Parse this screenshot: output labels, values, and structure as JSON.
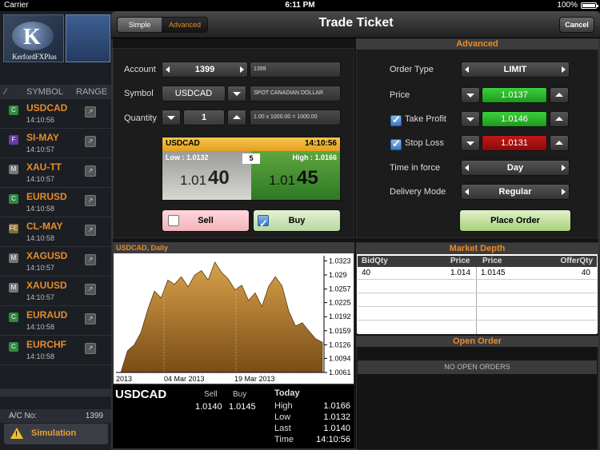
{
  "status_bar": {
    "carrier": "Carrier",
    "time": "6:11 PM",
    "battery": "100%"
  },
  "background_app": {
    "logo_text": "KerfordFXPlus",
    "columns": {
      "symbol": "SYMBOL",
      "range": "RANGE"
    },
    "watchlist": [
      {
        "badge": "C",
        "badge_color": "#2e8b3e",
        "symbol": "USDCAD",
        "time": "14:10:56"
      },
      {
        "badge": "F",
        "badge_color": "#6a3aa8",
        "symbol": "SI-MAY",
        "time": "14:10:57"
      },
      {
        "badge": "M",
        "badge_color": "#777777",
        "symbol": "XAU-TT",
        "time": "14:10:57"
      },
      {
        "badge": "C",
        "badge_color": "#2e8b3e",
        "symbol": "EURUSD",
        "time": "14:10:58"
      },
      {
        "badge": "FE",
        "badge_color": "#8a6a3a",
        "symbol": "CL-MAY",
        "time": "14:10:58"
      },
      {
        "badge": "M",
        "badge_color": "#777777",
        "symbol": "XAGUSD",
        "time": "14:10:57"
      },
      {
        "badge": "M",
        "badge_color": "#777777",
        "symbol": "XAUUSD",
        "time": "14:10:57"
      },
      {
        "badge": "C",
        "badge_color": "#2e8b3e",
        "symbol": "EURAUD",
        "time": "14:10:58"
      },
      {
        "badge": "C",
        "badge_color": "#2e8b3e",
        "symbol": "EURCHF",
        "time": "14:10:58"
      }
    ],
    "account_label": "A/C No:",
    "account_no": "1399",
    "mode": "Simulation"
  },
  "ticket": {
    "tabs": {
      "simple": "Simple",
      "advanced": "Advanced"
    },
    "title": "Trade Ticket",
    "cancel_label": "Cancel",
    "account": {
      "label": "Account",
      "value": "1399",
      "desc": "1399"
    },
    "symbol": {
      "label": "Symbol",
      "value": "USDCAD",
      "desc": "SPOT CANADIAN DOLLAR"
    },
    "quantity": {
      "label": "Quantity",
      "value": "1",
      "desc": "1.00 x 1000.00 = 1000.00"
    },
    "quote": {
      "symbol": "USDCAD",
      "time": "14:10:56",
      "low_label": "Low : 1.0132",
      "high_label": "High : 1.0166",
      "spread": "5",
      "bid_small": "1.01",
      "bid_big": "40",
      "ask_small": "1.01",
      "ask_big": "45"
    },
    "sell_label": "Sell",
    "buy_label": "Buy",
    "advanced": {
      "header": "Advanced",
      "order_type": {
        "label": "Order Type",
        "value": "LIMIT"
      },
      "price": {
        "label": "Price",
        "value": "1.0137"
      },
      "take_profit": {
        "label": "Take Profit",
        "value": "1.0146"
      },
      "stop_loss": {
        "label": "Stop Loss",
        "value": "1.0131"
      },
      "time_in_force": {
        "label": "Time in force",
        "value": "Day"
      },
      "delivery_mode": {
        "label": "Delivery Mode",
        "value": "Regular"
      },
      "place_order": "Place Order"
    },
    "market_depth": {
      "header": "Market Depth",
      "columns": {
        "bid_qty": "BidQty",
        "bid_price": "Price",
        "ask_price": "Price",
        "offer_qty": "OfferQty"
      },
      "row": {
        "bid_qty": "40",
        "bid_price": "1.014",
        "ask_price": "1.0145",
        "offer_qty": "40"
      }
    },
    "open_order": {
      "header": "Open Order",
      "empty": "NO OPEN ORDERS"
    },
    "summary": {
      "symbol": "USDCAD",
      "sell_label": "Sell",
      "buy_label": "Buy",
      "sell": "1.0140",
      "buy": "1.0145",
      "today_label": "Today",
      "rows": [
        {
          "label": "High",
          "value": "1.0166"
        },
        {
          "label": "Low",
          "value": "1.0132"
        },
        {
          "label": "Last",
          "value": "1.0140"
        },
        {
          "label": "Time",
          "value": "14:10:56"
        }
      ]
    }
  },
  "chart_data": {
    "type": "area",
    "title": "USDCAD, Daily",
    "x_ticks": [
      "2013",
      "04 Mar 2013",
      "19 Mar 2013"
    ],
    "y_ticks": [
      1.0323,
      1.029,
      1.0257,
      1.0225,
      1.0192,
      1.0159,
      1.0126,
      1.0094,
      1.0061
    ],
    "ylim": [
      1.0061,
      1.0335
    ],
    "fill_color": "#c89040",
    "values": [
      1.0061,
      1.0112,
      1.0126,
      1.0155,
      1.0208,
      1.0252,
      1.0236,
      1.0278,
      1.0268,
      1.0286,
      1.0262,
      1.029,
      1.03,
      1.0278,
      1.032,
      1.0296,
      1.028,
      1.0255,
      1.0266,
      1.023,
      1.0248,
      1.0216,
      1.0263,
      1.0286,
      1.0264,
      1.0205,
      1.017,
      1.0178,
      1.0158,
      1.014,
      1.0132
    ]
  }
}
